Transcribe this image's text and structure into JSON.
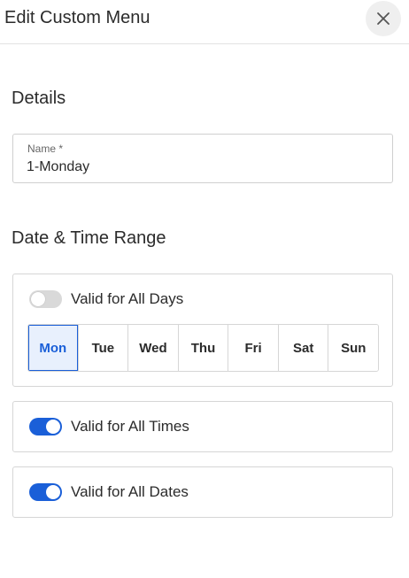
{
  "header": {
    "title": "Edit Custom Menu",
    "close_icon": "close-icon"
  },
  "details": {
    "title": "Details",
    "name_label": "Name *",
    "name_value": "1-Monday"
  },
  "range": {
    "title": "Date & Time Range",
    "all_days": {
      "label": "Valid for All Days",
      "enabled": false
    },
    "days": [
      {
        "label": "Mon",
        "selected": true
      },
      {
        "label": "Tue",
        "selected": false
      },
      {
        "label": "Wed",
        "selected": false
      },
      {
        "label": "Thu",
        "selected": false
      },
      {
        "label": "Fri",
        "selected": false
      },
      {
        "label": "Sat",
        "selected": false
      },
      {
        "label": "Sun",
        "selected": false
      }
    ],
    "all_times": {
      "label": "Valid for All Times",
      "enabled": true
    },
    "all_dates": {
      "label": "Valid for All Dates",
      "enabled": true
    }
  },
  "colors": {
    "accent": "#1a5fd8",
    "selected_bg": "#e8f0fd",
    "toggle_off": "#d9d9d9"
  }
}
